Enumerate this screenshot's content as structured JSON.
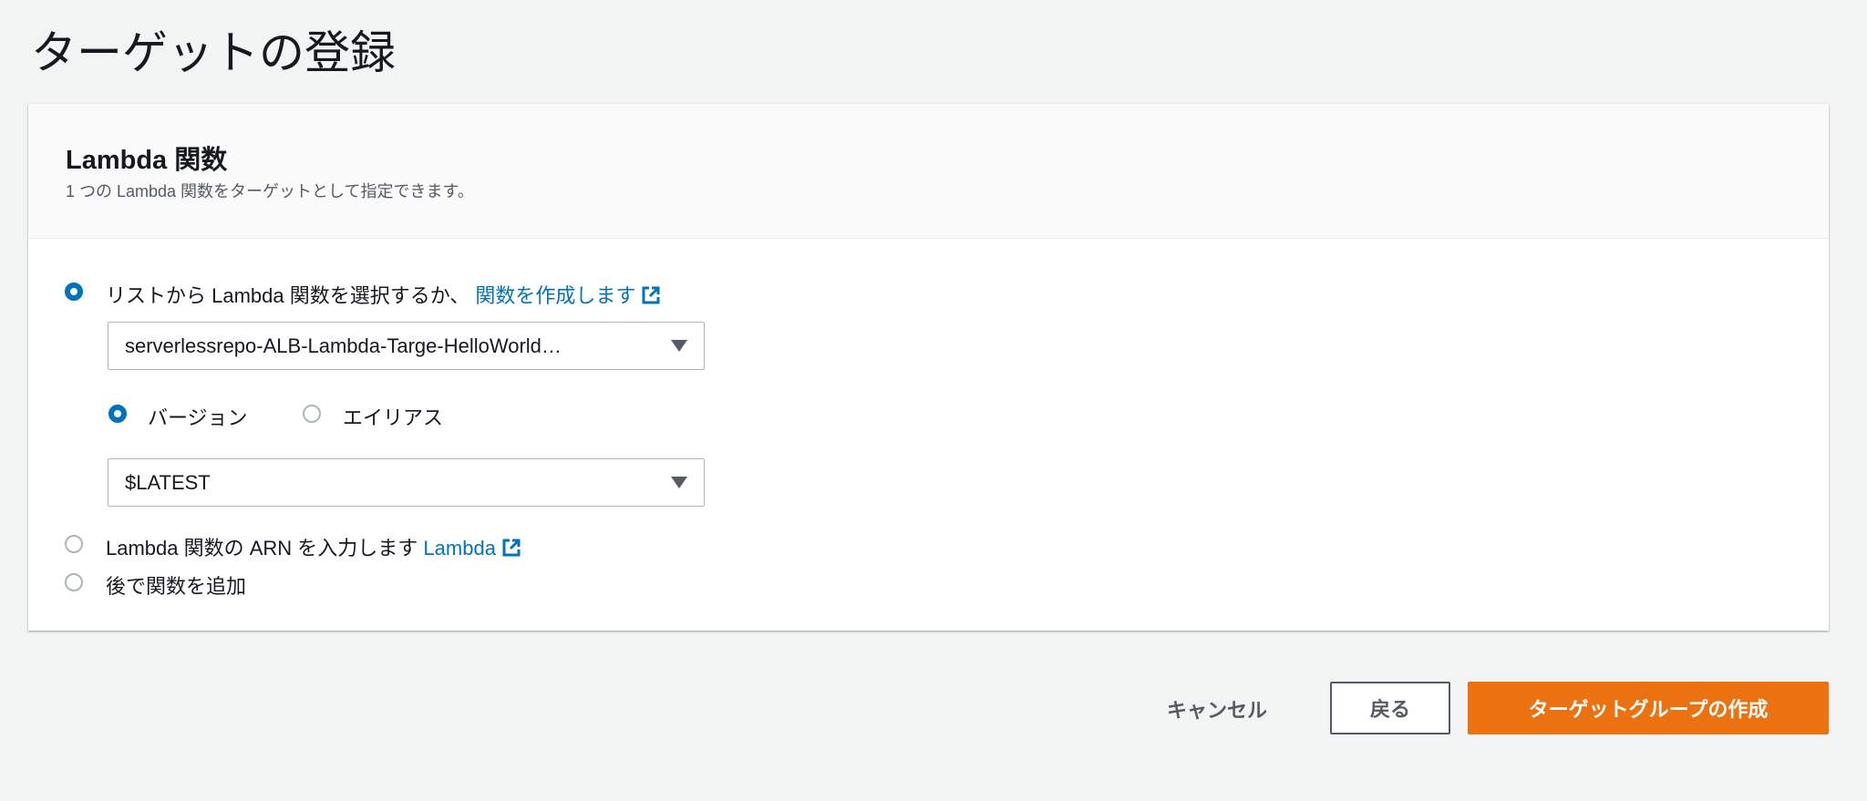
{
  "page": {
    "title": "ターゲットの登録"
  },
  "panel": {
    "title": "Lambda 関数",
    "subtitle": "1 つの Lambda 関数をターゲットとして指定できます。",
    "options": [
      {
        "label": "リストから Lambda 関数を選択するか、",
        "link": "関数を作成します",
        "selected": true
      },
      {
        "label": "Lambda 関数の ARN を入力します",
        "link": "Lambda",
        "selected": false
      },
      {
        "label": "後で関数を追加",
        "selected": false
      }
    ],
    "function_select": {
      "value": "serverlessrepo-ALB-Lambda-Targe-HelloWorld…"
    },
    "version_options": [
      {
        "label": "バージョン",
        "selected": true
      },
      {
        "label": "エイリアス",
        "selected": false
      }
    ],
    "version_select": {
      "value": "$LATEST"
    }
  },
  "footer": {
    "cancel_label": "キャンセル",
    "back_label": "戻る",
    "create_label": "ターゲットグループの作成"
  },
  "colors": {
    "accent": "#0073bb",
    "primary": "#ec7211"
  }
}
